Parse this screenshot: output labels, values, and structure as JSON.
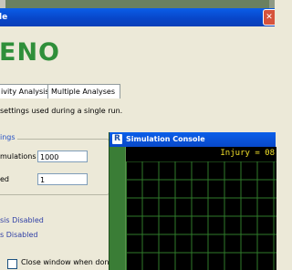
{
  "window": {
    "title_fragment": "le",
    "close_label": "✕"
  },
  "brand": {
    "text": "ENO"
  },
  "tabs": [
    {
      "label": "ivity Analysis",
      "active": false
    },
    {
      "label": "Multiple Analyses",
      "active": false
    }
  ],
  "description": "settings used during a single run.",
  "settings": {
    "group_label": "ings",
    "simulations_label": "mulations",
    "simulations_value": "1000",
    "seed_label": "ed",
    "seed_value": "1"
  },
  "status": {
    "line1": "sis Disabled",
    "line2": "s Disabled"
  },
  "options": {
    "close_when_done_label": "Close window when don",
    "close_when_done_checked": false
  },
  "console": {
    "logo": "R",
    "title": "Simulation Console",
    "readout": "Injury = 08",
    "colors": {
      "grid": "#2f7a2a",
      "readout": "#f2e02a",
      "background": "#000000"
    }
  }
}
